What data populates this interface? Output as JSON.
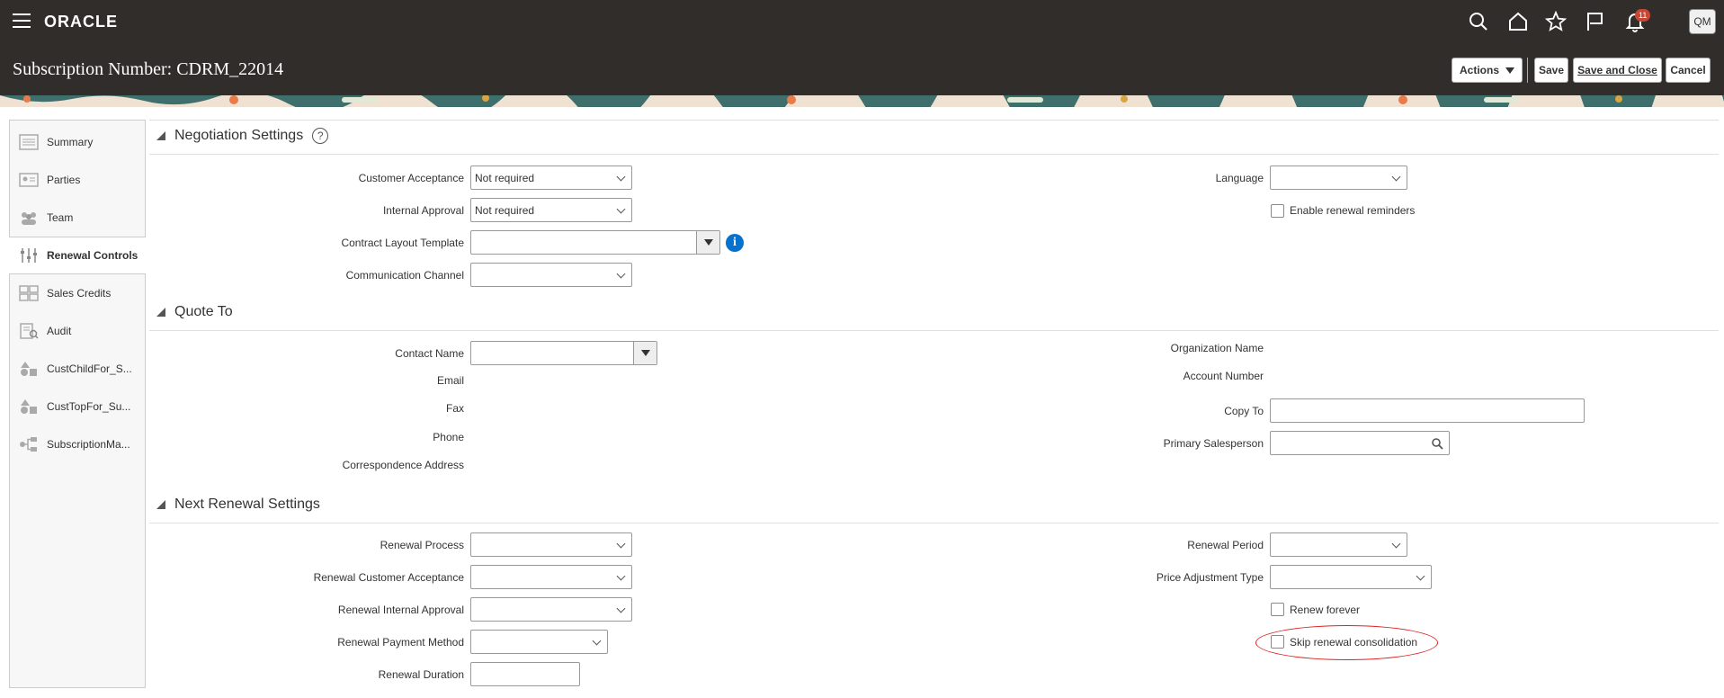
{
  "app": {
    "logo": "ORACLE",
    "notifications_count": "11",
    "avatar_initials": "QM"
  },
  "page": {
    "title": "Subscription Number: CDRM_22014"
  },
  "toolbar": {
    "actions_label": "Actions",
    "save_label": "Save",
    "save_close_label": "Save and Close",
    "cancel_label": "Cancel"
  },
  "nav": {
    "items": [
      {
        "label": "Summary",
        "icon": "summary-icon"
      },
      {
        "label": "Parties",
        "icon": "parties-icon"
      },
      {
        "label": "Team",
        "icon": "team-icon"
      },
      {
        "label": "Renewal Controls",
        "icon": "renewal-controls-icon",
        "selected": true
      },
      {
        "label": "Sales Credits",
        "icon": "sales-credits-icon"
      },
      {
        "label": "Audit",
        "icon": "audit-icon"
      },
      {
        "label": "CustChildFor_S...",
        "icon": "custom-shapes-icon"
      },
      {
        "label": "CustTopFor_Su...",
        "icon": "custom-shapes-icon"
      },
      {
        "label": "SubscriptionMa...",
        "icon": "hierarchy-icon"
      }
    ]
  },
  "negotiation": {
    "title": "Negotiation Settings",
    "customer_acceptance_label": "Customer Acceptance",
    "customer_acceptance_value": "Not required",
    "internal_approval_label": "Internal Approval",
    "internal_approval_value": "Not required",
    "layout_template_label": "Contract Layout Template",
    "communication_channel_label": "Communication Channel",
    "language_label": "Language",
    "enable_reminders_label": "Enable renewal reminders"
  },
  "quote_to": {
    "title": "Quote To",
    "contact_name_label": "Contact Name",
    "email_label": "Email",
    "fax_label": "Fax",
    "phone_label": "Phone",
    "address_label": "Correspondence Address",
    "org_name_label": "Organization Name",
    "account_number_label": "Account Number",
    "copy_to_label": "Copy To",
    "primary_salesperson_label": "Primary Salesperson"
  },
  "next_renewal": {
    "title": "Next Renewal Settings",
    "renewal_process_label": "Renewal Process",
    "renewal_customer_acceptance_label": "Renewal Customer Acceptance",
    "renewal_internal_approval_label": "Renewal Internal Approval",
    "renewal_payment_method_label": "Renewal Payment Method",
    "renewal_duration_label": "Renewal Duration",
    "renewal_period_label": "Renewal Period",
    "price_adjustment_type_label": "Price Adjustment Type",
    "renew_forever_label": "Renew forever",
    "skip_consolidation_label": "Skip renewal consolidation"
  },
  "colors": {
    "header_bg": "#312d2a",
    "info_blue": "#0572ce",
    "badge_red": "#c74634",
    "highlight_red": "#dd2222"
  }
}
